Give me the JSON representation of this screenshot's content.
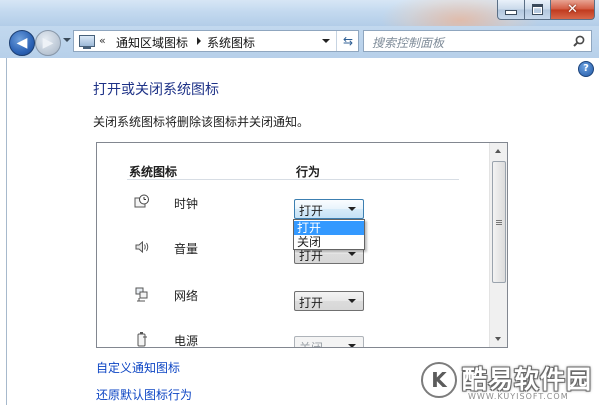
{
  "window": {
    "controls": {
      "minimize": "–",
      "maximize": "□",
      "close": "✕"
    }
  },
  "navigation": {
    "back_glyph": "◀",
    "forward_glyph": "▶",
    "address": {
      "overflow_chevron": "«",
      "crumbs": [
        "通知区域图标",
        "系统图标"
      ]
    },
    "refresh_glyph": "⇆",
    "search": {
      "placeholder": "搜索控制面板"
    }
  },
  "page": {
    "help_glyph": "?",
    "title": "打开或关闭系统图标",
    "description": "关闭系统图标将删除该图标并关闭通知。",
    "table": {
      "columns": {
        "icon": "系统图标",
        "behavior": "行为"
      },
      "rows": [
        {
          "icon": "clock-icon",
          "label": "时钟",
          "value": "打开",
          "state": "focused"
        },
        {
          "icon": "volume-icon",
          "label": "音量",
          "value": "打开",
          "state": "normal"
        },
        {
          "icon": "network-icon",
          "label": "网络",
          "value": "打开",
          "state": "normal"
        },
        {
          "icon": "power-icon",
          "label": "电源",
          "value": "关闭",
          "state": "disabled"
        }
      ],
      "dropdown": {
        "options": [
          "打开",
          "关闭"
        ],
        "selected_index": 0
      }
    },
    "links": {
      "customize": "自定义通知图标",
      "restore": "还原默认图标行为"
    }
  },
  "watermark": {
    "logo_letter": "K",
    "name": "酷易软件园",
    "url": "WWW.KUYISOFT.COM"
  },
  "colors": {
    "title_blue": "#1e3287",
    "link_blue": "#0e46c4",
    "selection_blue": "#3399ff"
  }
}
